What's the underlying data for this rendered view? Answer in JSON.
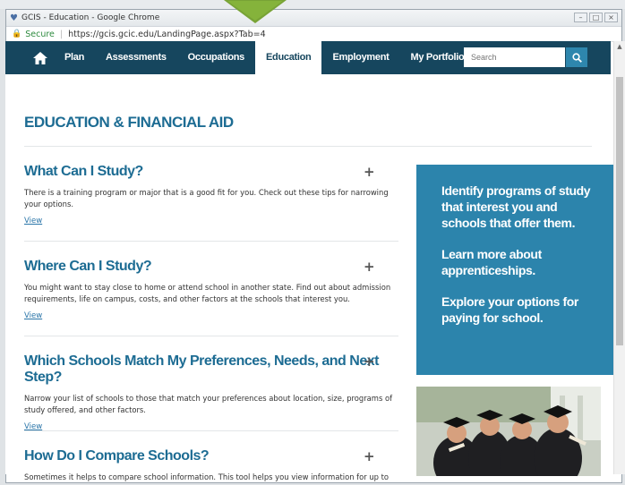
{
  "browser": {
    "tab_title": "GCIS - Education - Google Chrome",
    "secure_label": "Secure",
    "url": "https://gcis.gcic.edu/LandingPage.aspx?Tab=4",
    "favicon": "GCIS-logo-icon"
  },
  "nav": {
    "items": [
      {
        "label": "Plan"
      },
      {
        "label": "Assessments"
      },
      {
        "label": "Occupations"
      },
      {
        "label": "Education",
        "active": true
      },
      {
        "label": "Employment"
      },
      {
        "label": "My Portfolio"
      }
    ],
    "search_placeholder": "Search",
    "home_icon": "home-icon",
    "search_icon": "search-icon"
  },
  "page": {
    "title": "EDUCATION & FINANCIAL AID",
    "sections": [
      {
        "title": "What Can I Study?",
        "body": "There is a training program or major that is a good fit for you. Check out these tips for narrowing your options.",
        "link": "View"
      },
      {
        "title": "Where Can I Study?",
        "body": "You might want to stay close to home or attend school in another state. Find out about admission requirements, life on campus, costs, and other factors at the schools that interest you.",
        "link": "View"
      },
      {
        "title": "Which Schools Match My Preferences, Needs, and Next Step?",
        "body": "Narrow your list of schools to those that match your preferences about location, size, programs of study offered, and other factors.",
        "link": "View"
      },
      {
        "title": "How Do I Compare Schools?",
        "body": "Sometimes it helps to compare school information. This tool helps you view information for up to",
        "link": ""
      }
    ],
    "expand_symbol": "+",
    "promo": [
      "Identify programs of study that interest you and schools that offer them.",
      "Learn more about apprenticeships.",
      "Explore your options for paying for school."
    ]
  },
  "colors": {
    "nav_bg": "#16465e",
    "accent": "#1d6c93",
    "promo_bg": "#2c84ac",
    "pointer": "#78a336"
  }
}
